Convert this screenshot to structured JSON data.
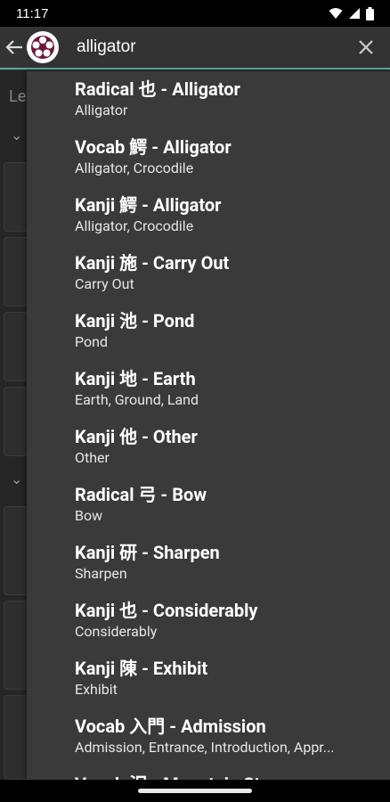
{
  "status": {
    "time": "11:17"
  },
  "search": {
    "value": "alligator"
  },
  "background": {
    "label": "Le"
  },
  "results": [
    {
      "title": "Radical 也 - Alligator",
      "subtitle": "Alligator"
    },
    {
      "title": "Vocab 鰐 - Alligator",
      "subtitle": "Alligator, Crocodile"
    },
    {
      "title": "Kanji 鰐 - Alligator",
      "subtitle": "Alligator, Crocodile"
    },
    {
      "title": "Kanji 施 - Carry Out",
      "subtitle": "Carry Out"
    },
    {
      "title": "Kanji 池 - Pond",
      "subtitle": "Pond"
    },
    {
      "title": "Kanji 地 - Earth",
      "subtitle": "Earth, Ground, Land"
    },
    {
      "title": "Kanji 他 - Other",
      "subtitle": "Other"
    },
    {
      "title": "Radical 弓 - Bow",
      "subtitle": "Bow"
    },
    {
      "title": "Kanji 研 - Sharpen",
      "subtitle": "Sharpen"
    },
    {
      "title": "Kanji 也 - Considerably",
      "subtitle": "Considerably"
    },
    {
      "title": "Kanji 陳 - Exhibit",
      "subtitle": "Exhibit"
    },
    {
      "title": "Vocab 入門 - Admission",
      "subtitle": "Admission, Entrance, Introduction, Appr..."
    },
    {
      "title": "Vocab 沢 - Mountain Stream",
      "subtitle": ""
    }
  ],
  "colors": {
    "accent": "#5fa8a0",
    "appbar": "#333333",
    "dropdown": "#3a3a3a"
  },
  "icons": [
    "back-arrow-icon",
    "app-logo-icon",
    "clear-icon",
    "wifi-icon",
    "signal-icon",
    "battery-icon"
  ]
}
